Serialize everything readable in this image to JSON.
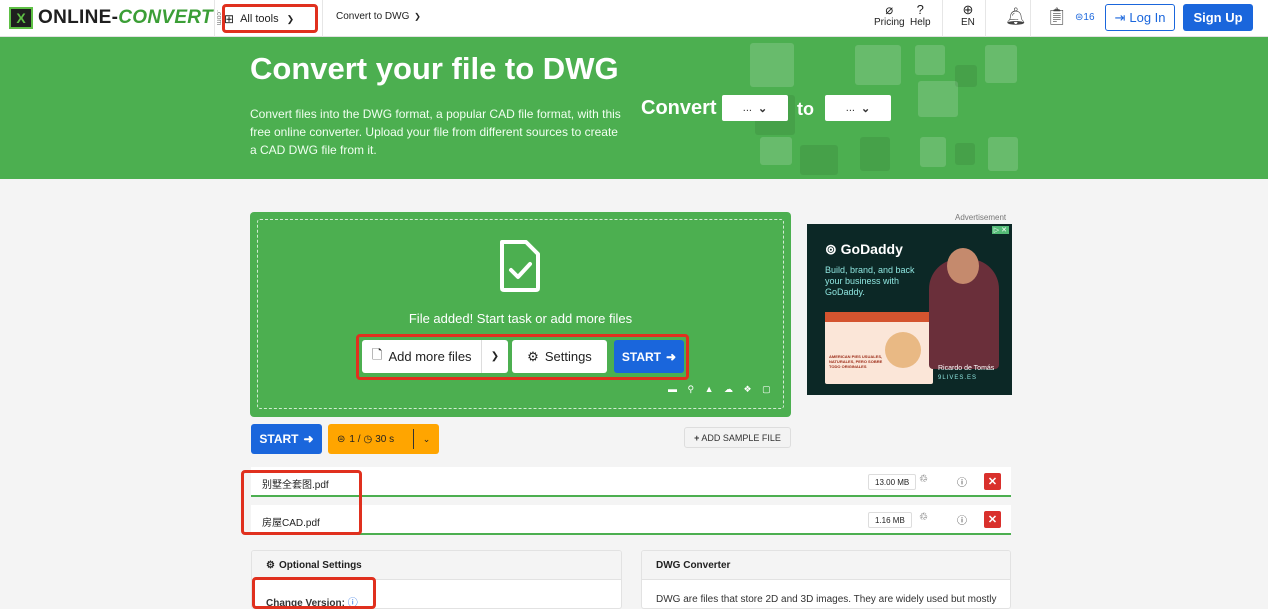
{
  "header": {
    "logo_main": "ONLINE-",
    "logo_accent": "CONVERT",
    "logo_com": ".com",
    "all_tools_label": "All tools",
    "convert_menu_label": "Convert to DWG",
    "pricing_label": "Pricing",
    "help_label": "Help",
    "language_label": "EN",
    "credits_label": "16",
    "login_label": "Log In",
    "signup_label": "Sign Up"
  },
  "hero": {
    "title": "Convert your file to DWG",
    "description": "Convert files into the DWG format, a popular CAD file format, with this free online converter. Upload your file from different sources to create a CAD DWG file from it.",
    "convert_label": "Convert",
    "from_value": "...",
    "to_label": "to",
    "to_value": "..."
  },
  "dropzone": {
    "status_text": "File added! Start task or add more files",
    "add_more_label": "Add more files",
    "settings_label": "Settings",
    "start_label": "START"
  },
  "ad": {
    "label": "Advertisement",
    "brand": "GoDaddy",
    "tagline": "Build, brand, and back your business with GoDaddy.",
    "web_text": "AMERICAN PIES USUALES, NATURALES, PERO SOBRE TODO ORIGINALES",
    "person_name": "Ricardo de Tomás",
    "person_site": "9LIVES.ES"
  },
  "actions": {
    "start_label": "START",
    "credits_cost": "1 /",
    "time": "30 s",
    "add_sample_label": "ADD SAMPLE FILE"
  },
  "files": [
    {
      "name": "别墅全套图.pdf",
      "size": "13.00 MB"
    },
    {
      "name": "房屋CAD.pdf",
      "size": "1.16 MB"
    }
  ],
  "optional": {
    "title": "Optional Settings",
    "change_version_label": "Change Version:"
  },
  "dwg_info": {
    "title": "DWG Converter",
    "text": "DWG are files that store 2D and 3D images. They are widely used but mostly"
  },
  "colors": {
    "green": "#4caf50",
    "blue": "#1a66dc",
    "orange": "#ffa500",
    "red_highlight": "#e0301e"
  }
}
